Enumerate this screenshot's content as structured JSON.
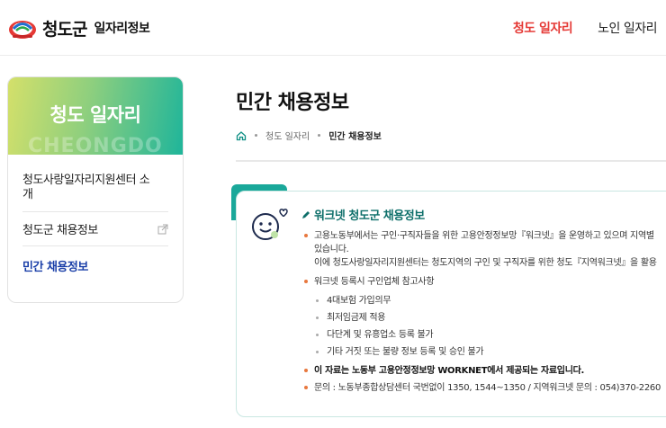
{
  "header": {
    "logo_name": "청도군",
    "logo_sub": "일자리정보",
    "nav": [
      "청도 일자리",
      "노인 일자리"
    ]
  },
  "sidebar": {
    "banner_title": "청도 일자리",
    "banner_bg": "CHEONGDO",
    "items": [
      {
        "label_line1": "청도사랑일자리지원센터 소",
        "label_line2": "개"
      },
      {
        "label": "청도군 채용정보",
        "icon": "external-link-icon"
      },
      {
        "label": "민간 채용정보"
      }
    ]
  },
  "main": {
    "title": "민간 채용정보",
    "breadcrumb": [
      "청도 일자리",
      "민간 채용정보"
    ],
    "card": {
      "title": "워크넷 청도군 채용정보",
      "p1_line1": "고용노동부에서는 구인·구직자들을 위한 고용안정정보망『워크넷』을 운영하고 있으며 지역별",
      "p1_line2": "있습니다.",
      "p1_line3": "이에 청도사랑일자리지원센터는 청도지역의 구인 및 구직자를 위한 청도『지역워크넷』을 활용",
      "p2": "워크넷 등록시 구인업체 참고사항",
      "sub_items": [
        "4대보험 가입의무",
        "최저임금제 적용",
        "다단계 및 유흥업소 등록 불가",
        "기타 거짓 또는 불량 정보 등록 및 승인 불가"
      ],
      "notice": "이 자료는 노동부 고용안정정보망 WORKNET에서 제공되는 자료입니다.",
      "contact": "문의 : 노동부종합상담센터 국번없이 1350, 1544~1350 / 지역워크넷 문의 : 054)370-2260"
    }
  },
  "colors": {
    "accent_red": "#e53935",
    "active_blue": "#1a3fa8",
    "teal": "#1aa89a",
    "bullet_orange": "#e8783e"
  }
}
